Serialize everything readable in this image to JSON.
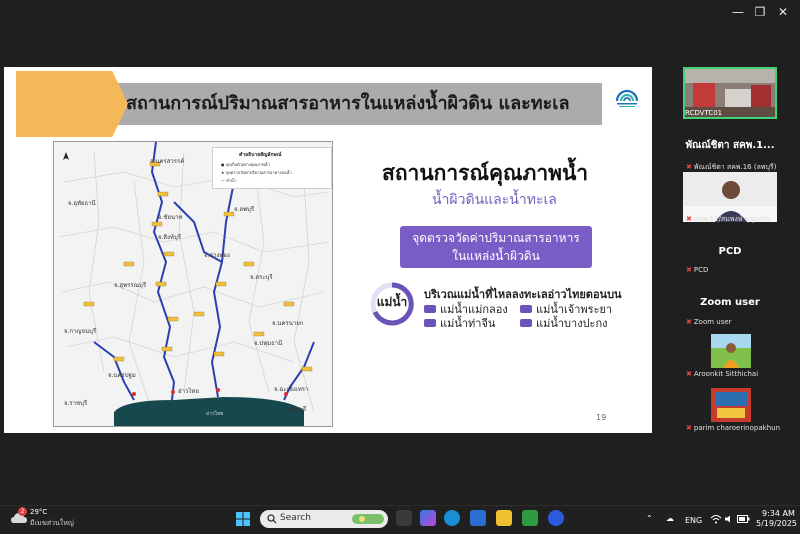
{
  "window": {
    "minimize_glyph": "—",
    "maximize_glyph": "❐",
    "close_glyph": "✕"
  },
  "slide": {
    "title": "สถานการณ์ปริมาณสารอาหารในแหล่งน้ำผิวดิน และทะเล",
    "heading": "สถานการณ์คุณภาพน้ำ",
    "subheading": "น้ำผิวดินและน้ำทะเล",
    "box_line1": "จุดตรวจวัดค่าปริมาณสารอาหาร",
    "box_line2": "ในแหล่งน้ำผิวดิน",
    "ring_label": "แม่น้ำ",
    "rivers_heading": "บริเวณแม่น้ำที่ไหลลงทะเลอ่าวไทยตอนบน",
    "rivers": [
      "แม่น้ำแม่กลอง",
      "แม่น้ำเจ้าพระยา",
      "แม่น้ำท่าจีน",
      "แม่น้ำบางปะกง"
    ],
    "page_number": "19",
    "accent_color": "#7a5cc7",
    "banner_color": "#f5b859"
  },
  "map": {
    "legend_title": "คำอธิบายสัญลักษณ์",
    "legend_items": [
      "จุดเก็บตัวอย่างคุณภาพน้ำ",
      "จุดตรวจวัดค่าปริมาณสารอาหารบ่อน้ำ",
      "ลำน้ำ"
    ],
    "provinces": [
      "จ.นครสวรรค์",
      "จ.อุทัยธานี",
      "จ.ลพบุรี",
      "จ.ชัยนาท",
      "จ.สิงห์บุรี",
      "จ.อ่างทอง",
      "จ.สระบุรี",
      "จ.สุพรรณบุรี",
      "จ.กาญจนบุรี",
      "จ.นครนายก",
      "จ.ปทุมธานี",
      "จ.นครปฐม",
      "จ.ราชบุรี",
      "จ.ฉะเชิงเทรา",
      "จ.ชลบุรี",
      "อ่าวไทย"
    ],
    "sea_label": "อ่าวไทย"
  },
  "participants": [
    {
      "name": "RCDVTC01",
      "type": "video",
      "muted": false
    },
    {
      "name": "พัณณ์ชิตา สคพ.1...",
      "sub": "พัณณ์ชิตา สคพ.16 (ลพบุรี)",
      "type": "video",
      "muted": true
    },
    {
      "name": "สคพ.11/สมพงษ์ บุญเสริม",
      "type": "video",
      "muted": true
    },
    {
      "name": "PCD",
      "sub": "PCD",
      "type": "name",
      "muted": true
    },
    {
      "name": "Zoom user",
      "sub": "Zoom user",
      "type": "name",
      "muted": true
    },
    {
      "name": "Aroonkit Sitthichai",
      "type": "photo",
      "muted": true
    },
    {
      "name": "parim charoerinopakhun",
      "type": "photo",
      "muted": true
    }
  ],
  "taskbar": {
    "weather_temp": "29°C",
    "weather_desc": "มีเมฆส่วนใหญ่",
    "weather_badge": "2",
    "search_placeholder": "Search",
    "language": "ENG",
    "time": "9:34 AM",
    "date": "5/19/2025"
  }
}
